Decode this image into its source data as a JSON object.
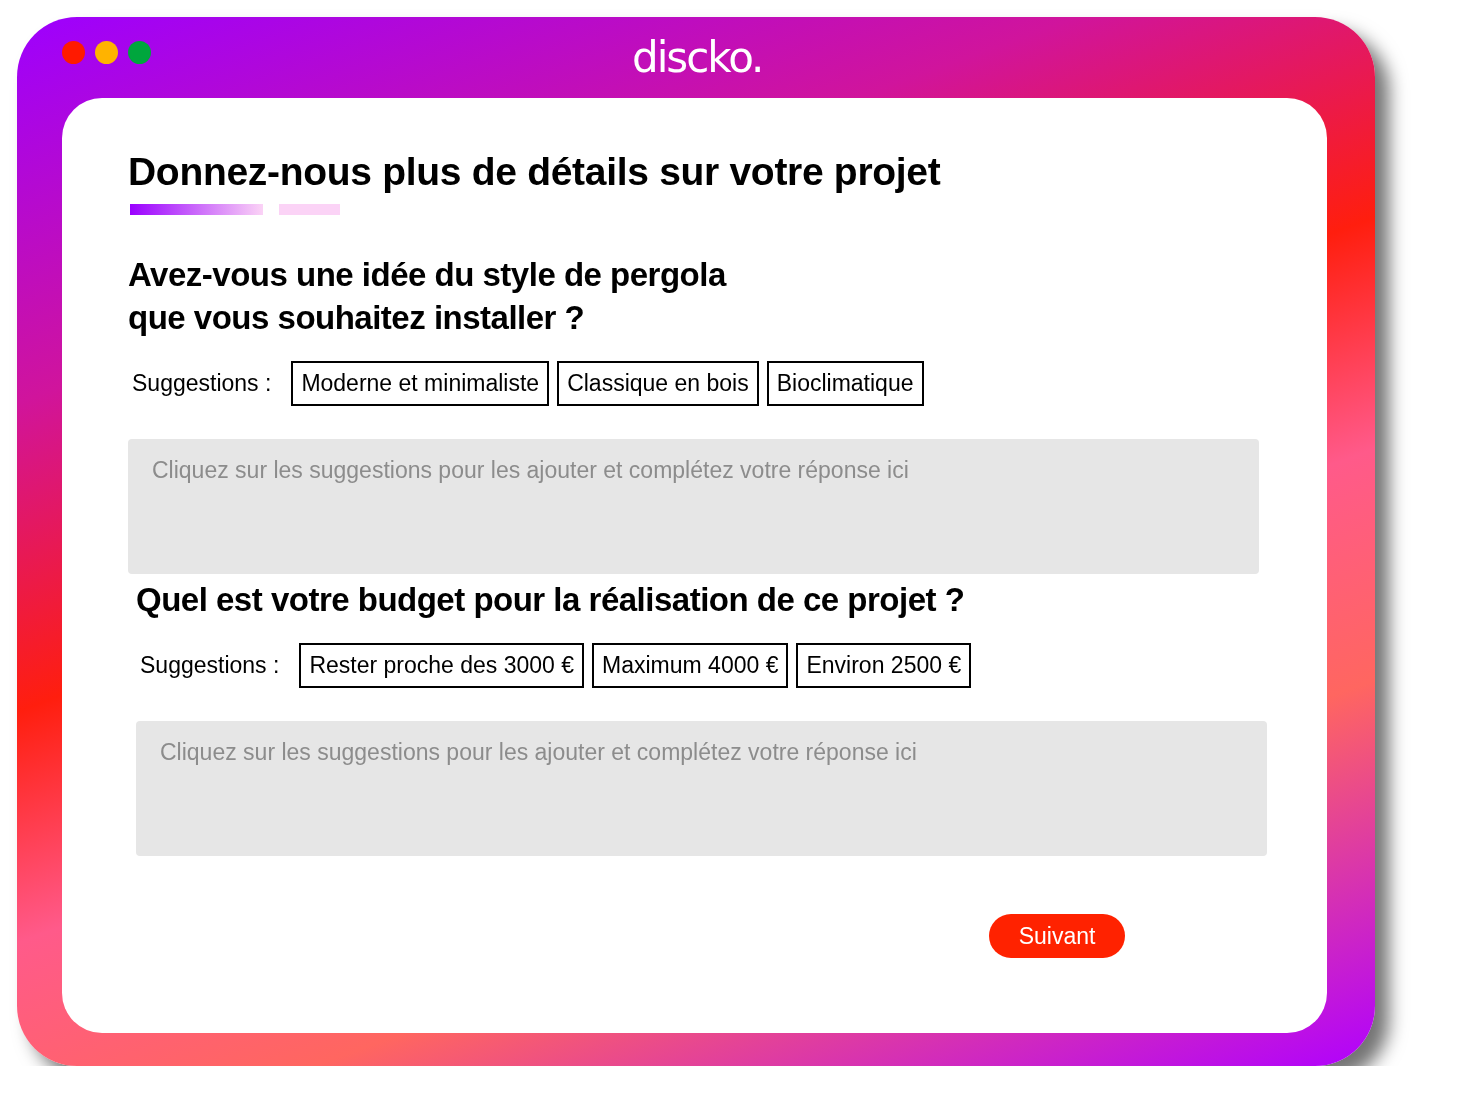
{
  "window": {
    "title": "discko."
  },
  "heading": "Donnez-nous plus de détails sur votre projet",
  "steps": [
    {
      "selected": true
    },
    {
      "selected": false
    }
  ],
  "questions": [
    {
      "title": "Avez-vous une idée du style de pergola\nque vous souhaitez installer ?",
      "suggestions_label": "Suggestions :",
      "suggestions": [
        "Moderne et minimaliste",
        "Classique en bois",
        "Bioclimatique"
      ],
      "answer": {
        "placeholder": "Cliquez sur les suggestions pour les ajouter et complétez votre réponse ici"
      }
    },
    {
      "title": "Quel est votre budget pour la réalisation de ce projet ?",
      "suggestions_label": "Suggestions :",
      "suggestions": [
        "Rester proche des 3000 €",
        "Maximum 4000 €",
        "Environ 2500 €"
      ],
      "answer": {
        "placeholder": "Cliquez sur les suggestions pour les ajouter et complétez votre réponse ici"
      }
    }
  ],
  "next_button": "Suivant"
}
